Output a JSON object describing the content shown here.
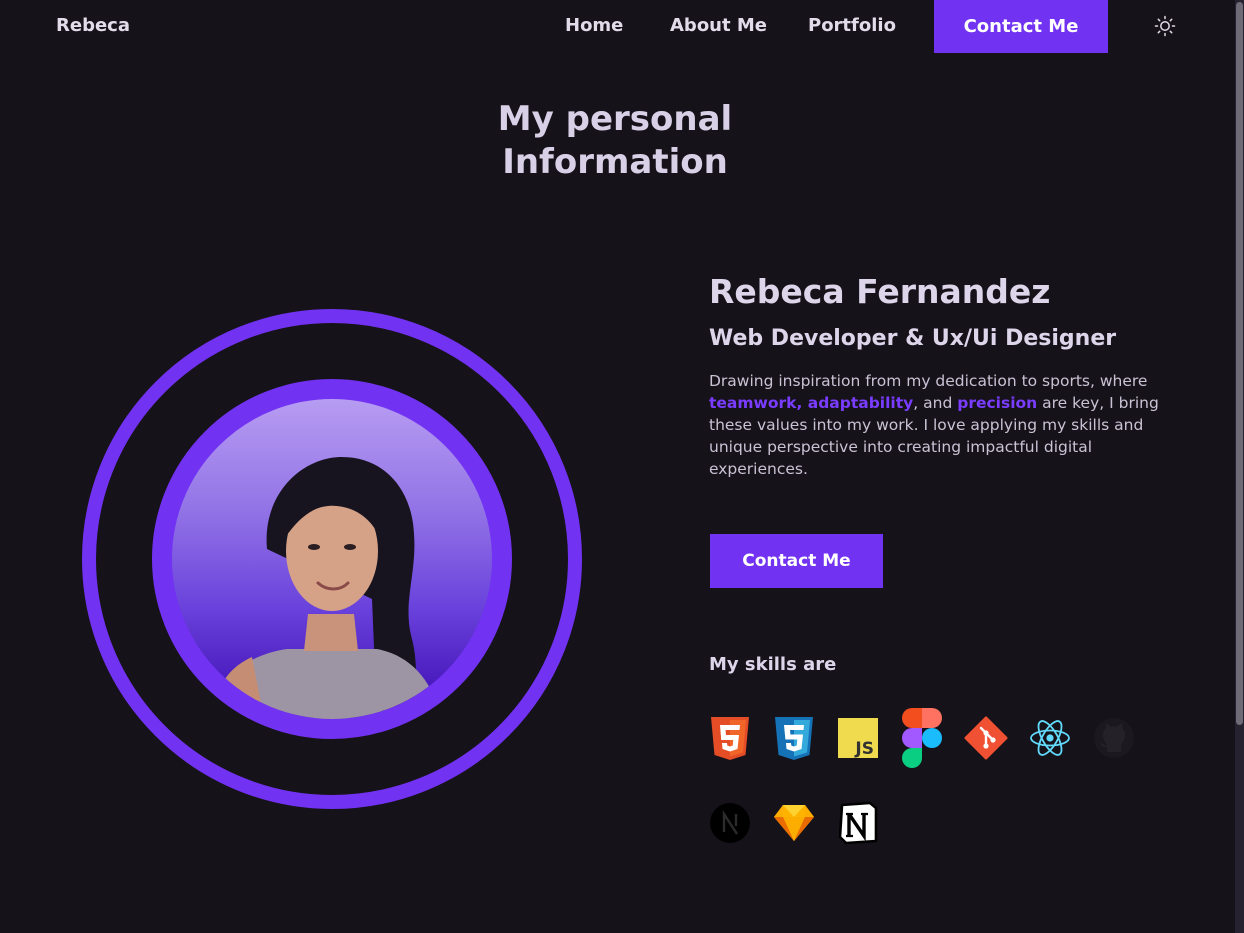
{
  "nav": {
    "logo": "Rebeca",
    "links": [
      "Home",
      "About Me",
      "Portfolio"
    ],
    "contact": "Contact Me"
  },
  "page": {
    "title_line1": "My personal",
    "title_line2": "Information"
  },
  "profile": {
    "name": "Rebeca Fernandez",
    "role": "Web Developer & Ux/Ui Designer",
    "bio_1": "Drawing inspiration from my dedication to sports, where ",
    "bio_hl_1": "teamwork, adaptability",
    "bio_2": ", and ",
    "bio_hl_2": "precision",
    "bio_3": " are key, I bring these values into my work. I love applying my skills and unique perspective into creating impactful digital experiences.",
    "cta": "Contact Me"
  },
  "skills": {
    "title": "My skills are",
    "icons": [
      "html5-icon",
      "css3-icon",
      "javascript-icon",
      "figma-icon",
      "git-icon",
      "react-icon",
      "github-icon",
      "nextjs-icon",
      "sketch-icon",
      "notion-icon"
    ]
  },
  "colors": {
    "accent": "#7232f2",
    "background": "#16121a",
    "text": "#e2dcea"
  }
}
